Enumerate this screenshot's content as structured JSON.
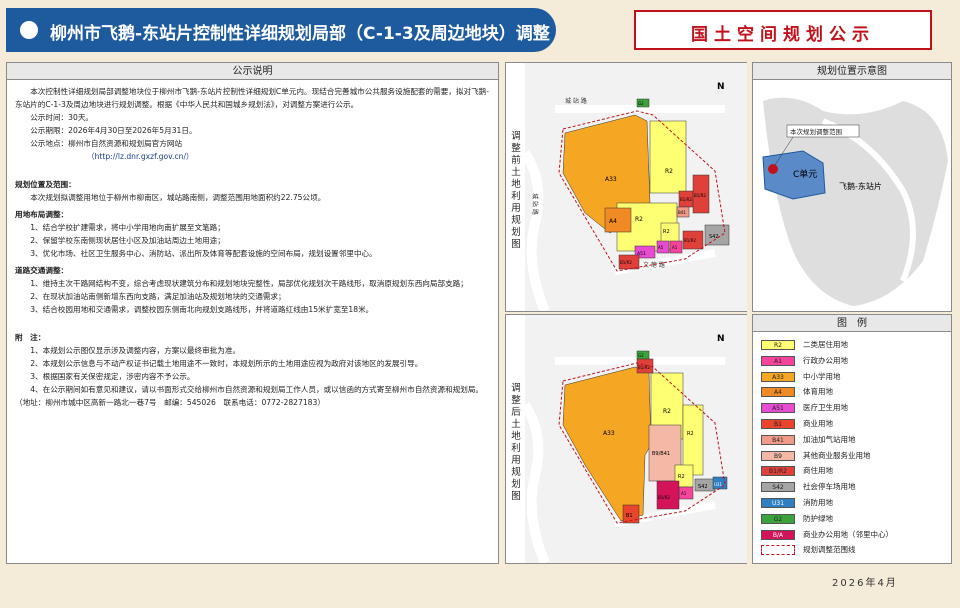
{
  "header": {
    "title": "柳州市飞鹅-东站片控制性详细规划局部（C-1-3及周边地块）调整",
    "notice": "国土空间规划公示"
  },
  "notice_panel": {
    "title": "公示说明",
    "intro": "本次控制性详细规划局部调整地块位于柳州市飞鹅-东站片控制性详细规划C单元内。现结合完善城市公共服务设施配套的需要，拟对飞鹅-东站片的C-1-3及周边地块进行规划调整。根据《中华人民共和国城乡规划法》，对调整方案进行公示。",
    "period": "公示时间：30天。",
    "dates": "公示期限：2026年4月30日至2026年5月31日。",
    "place": "公示地点：柳州市自然资源和规划局官方网站",
    "url": "（http://lz.dnr.gxzf.gov.cn/）",
    "scope_heading": "规划位置及范围：",
    "scope_text": "本次规划拟调整用地位于柳州市柳南区，城站路南侧，调整范围用地面积约22.75公顷。",
    "landuse_heading": "用地布局调整：",
    "landuse_items": [
      "1、结合学校扩建需求，将中小学用地向南扩展至文笔路；",
      "2、保留学校东南侧现状居住小区及加油站周边土地用途；",
      "3、优化市场、社区卫生服务中心、消防站、派出所及体育等配套设施的空间布局，规划设置邻里中心。"
    ],
    "road_heading": "道路交通调整：",
    "road_items": [
      "1、维持主次干路网结构不变，综合考虑现状建筑分布和规划地块完整性，局部优化规划次干路线形，取消原规划东西向局部支路；",
      "2、在现状加油站南侧新增东西向支路，满足加油站及规划地块的交通需求；",
      "3、结合校园用地和交通需求，调整校园东侧南北向规划支路线形，并将道路红线由15米扩宽至18米。"
    ],
    "notes_heading": "附　注：",
    "notes_items": [
      "1、本规划公示图仅显示涉及调整内容，方案以最终审批为准。",
      "2、本规划公示信息与不动产权证书记载土地用途不一致时，本规划所示的土地用途应视为政府对该地区的发展引导。",
      "3、根据国家有关保密规定，涉密内容不予公示。",
      "4、在公示期间如有意见和建议，请以书面形式交给柳州市自然资源和规划局工作人员，或以信函的方式寄至柳州市自然资源和规划局。（地址：柳州市城中区高新一路北一巷7号　邮编：545026　联系电话：0772-2827183）"
    ]
  },
  "maps": {
    "before_label": "调整前土地利用规划图",
    "after_label": "调整后土地利用规划图",
    "road_north": "城 站 路",
    "road_west": "城 站 路",
    "road_south": "文 笔 路",
    "north": "N",
    "before_parcels": [
      "A33",
      "R2",
      "R2",
      "A4",
      "R2",
      "B1/R2",
      "A5",
      "A1",
      "B1/R2",
      "B41",
      "A51",
      "B1/R2",
      "S42",
      "B1/R2",
      "G2"
    ],
    "after_parcels": [
      "A33",
      "R2",
      "R2",
      "B9/B41",
      "R2",
      "A1",
      "B1/R2",
      "B1",
      "G2",
      "S42",
      "U31",
      "B1/R2"
    ]
  },
  "location": {
    "title": "规划位置示意图",
    "callout": "本次规划调整范围",
    "unit": "C单元",
    "area": "飞鹅-东站片"
  },
  "legend": {
    "title": "图　例",
    "items": [
      {
        "code": "R2",
        "label": "二类居住用地",
        "color": "#ffff73"
      },
      {
        "code": "A1",
        "label": "行政办公用地",
        "color": "#f7449b"
      },
      {
        "code": "A33",
        "label": "中小学用地",
        "color": "#f5a623"
      },
      {
        "code": "A4",
        "label": "体育用地",
        "color": "#f08a24"
      },
      {
        "code": "A51",
        "label": "医疗卫生用地",
        "color": "#e64bd2"
      },
      {
        "code": "B1",
        "label": "商业用地",
        "color": "#e8452c"
      },
      {
        "code": "B41",
        "label": "加油加气站用地",
        "color": "#f29a88"
      },
      {
        "code": "B9",
        "label": "其他商业服务业用地",
        "color": "#f4b8a6"
      },
      {
        "code": "B1/R2",
        "label": "商住用地",
        "color": "#e0403a"
      },
      {
        "code": "S42",
        "label": "社会停车场用地",
        "color": "#a5a5a5"
      },
      {
        "code": "U31",
        "label": "消防用地",
        "color": "#2f7fc1"
      },
      {
        "code": "G2",
        "label": "防护绿地",
        "color": "#3ca33c"
      },
      {
        "code": "B/A",
        "label": "商业办公用地（邻里中心）",
        "color": "#d4145a"
      },
      {
        "code": "",
        "label": "规划调整范围线",
        "color": "#ffffff"
      }
    ]
  },
  "date": "2026年4月"
}
